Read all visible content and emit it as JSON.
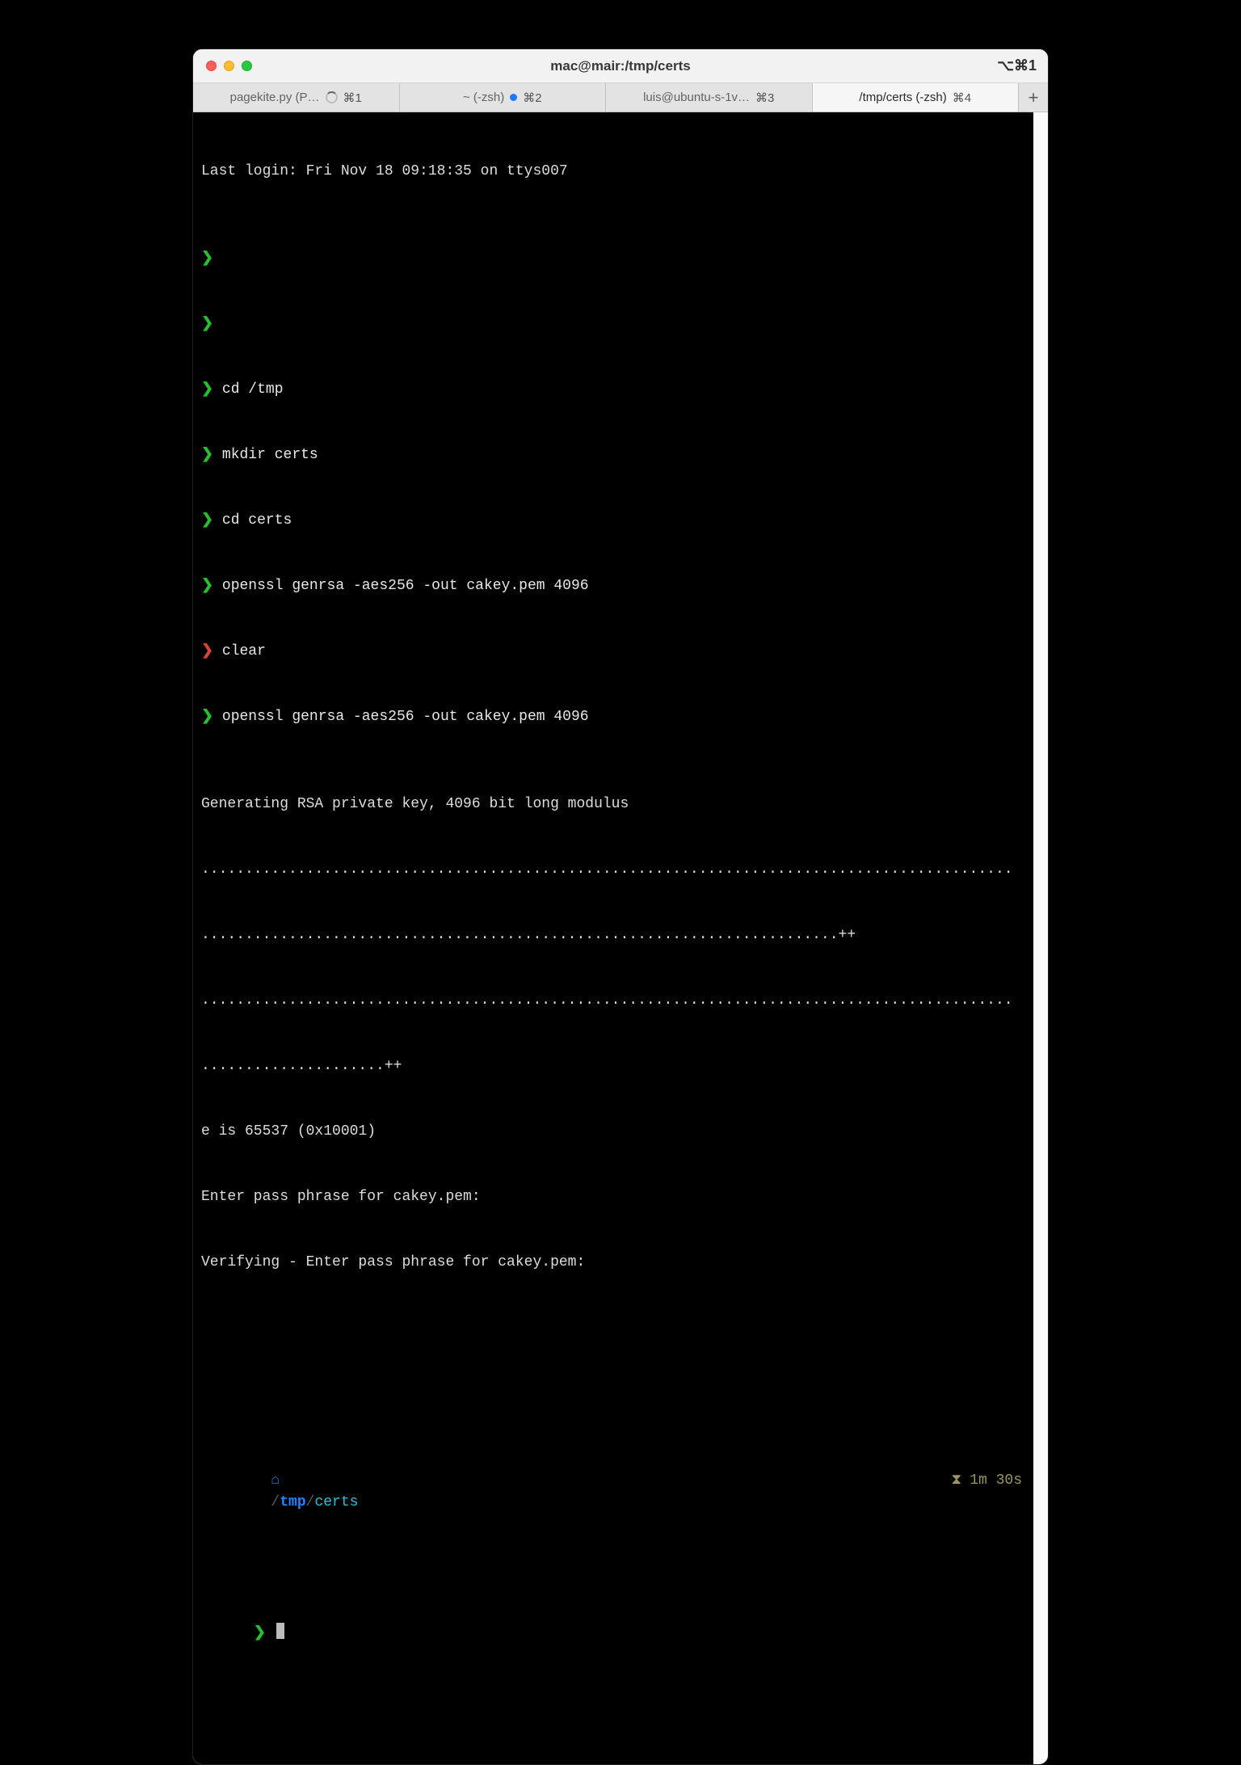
{
  "window": {
    "title": "mac@mair:/tmp/certs",
    "right_badge": "⌥⌘1"
  },
  "tabs": [
    {
      "label": "pagekite.py (P…",
      "shortcut": "⌘1",
      "spinner": true,
      "active": false,
      "dot": false
    },
    {
      "label": "~ (-zsh)",
      "shortcut": "⌘2",
      "spinner": false,
      "active": false,
      "dot": true
    },
    {
      "label": "luis@ubuntu-s-1v…",
      "shortcut": "⌘3",
      "spinner": false,
      "active": false,
      "dot": false
    },
    {
      "label": "/tmp/certs (-zsh)",
      "shortcut": "⌘4",
      "spinner": false,
      "active": true,
      "dot": false
    }
  ],
  "newtab_glyph": "+",
  "terminal": {
    "last_login": "Last login: Fri Nov 18 09:18:35 on ttys007",
    "lines": [
      {
        "prompt": "❯",
        "prompt_color": "green",
        "text": ""
      },
      {
        "prompt": "❯",
        "prompt_color": "green",
        "text": ""
      },
      {
        "prompt": "❯",
        "prompt_color": "green",
        "text": "cd /tmp"
      },
      {
        "prompt": "❯",
        "prompt_color": "green",
        "text": "mkdir certs"
      },
      {
        "prompt": "❯",
        "prompt_color": "green",
        "text": "cd certs"
      },
      {
        "prompt": "❯",
        "prompt_color": "green",
        "text": "openssl genrsa -aes256 -out cakey.pem 4096"
      },
      {
        "prompt": "❯",
        "prompt_color": "red",
        "text": "clear"
      },
      {
        "prompt": "❯",
        "prompt_color": "green",
        "text": "openssl genrsa -aes256 -out cakey.pem 4096"
      }
    ],
    "output": [
      "Generating RSA private key, 4096 bit long modulus",
      ".............................................................................................",
      ".........................................................................++",
      ".............................................................................................",
      ".....................++",
      "e is 65537 (0x10001)",
      "Enter pass phrase for cakey.pem:",
      "Verifying - Enter pass phrase for cakey.pem:"
    ],
    "cwd": {
      "apple_glyph": "",
      "folder_glyph": "⌂",
      "prefix": "/",
      "seg1": "tmp",
      "sep": "/",
      "seg2": "certs"
    },
    "timer": {
      "glyph": "⧗",
      "text": "1m 30s"
    },
    "final_prompt": "❯"
  }
}
